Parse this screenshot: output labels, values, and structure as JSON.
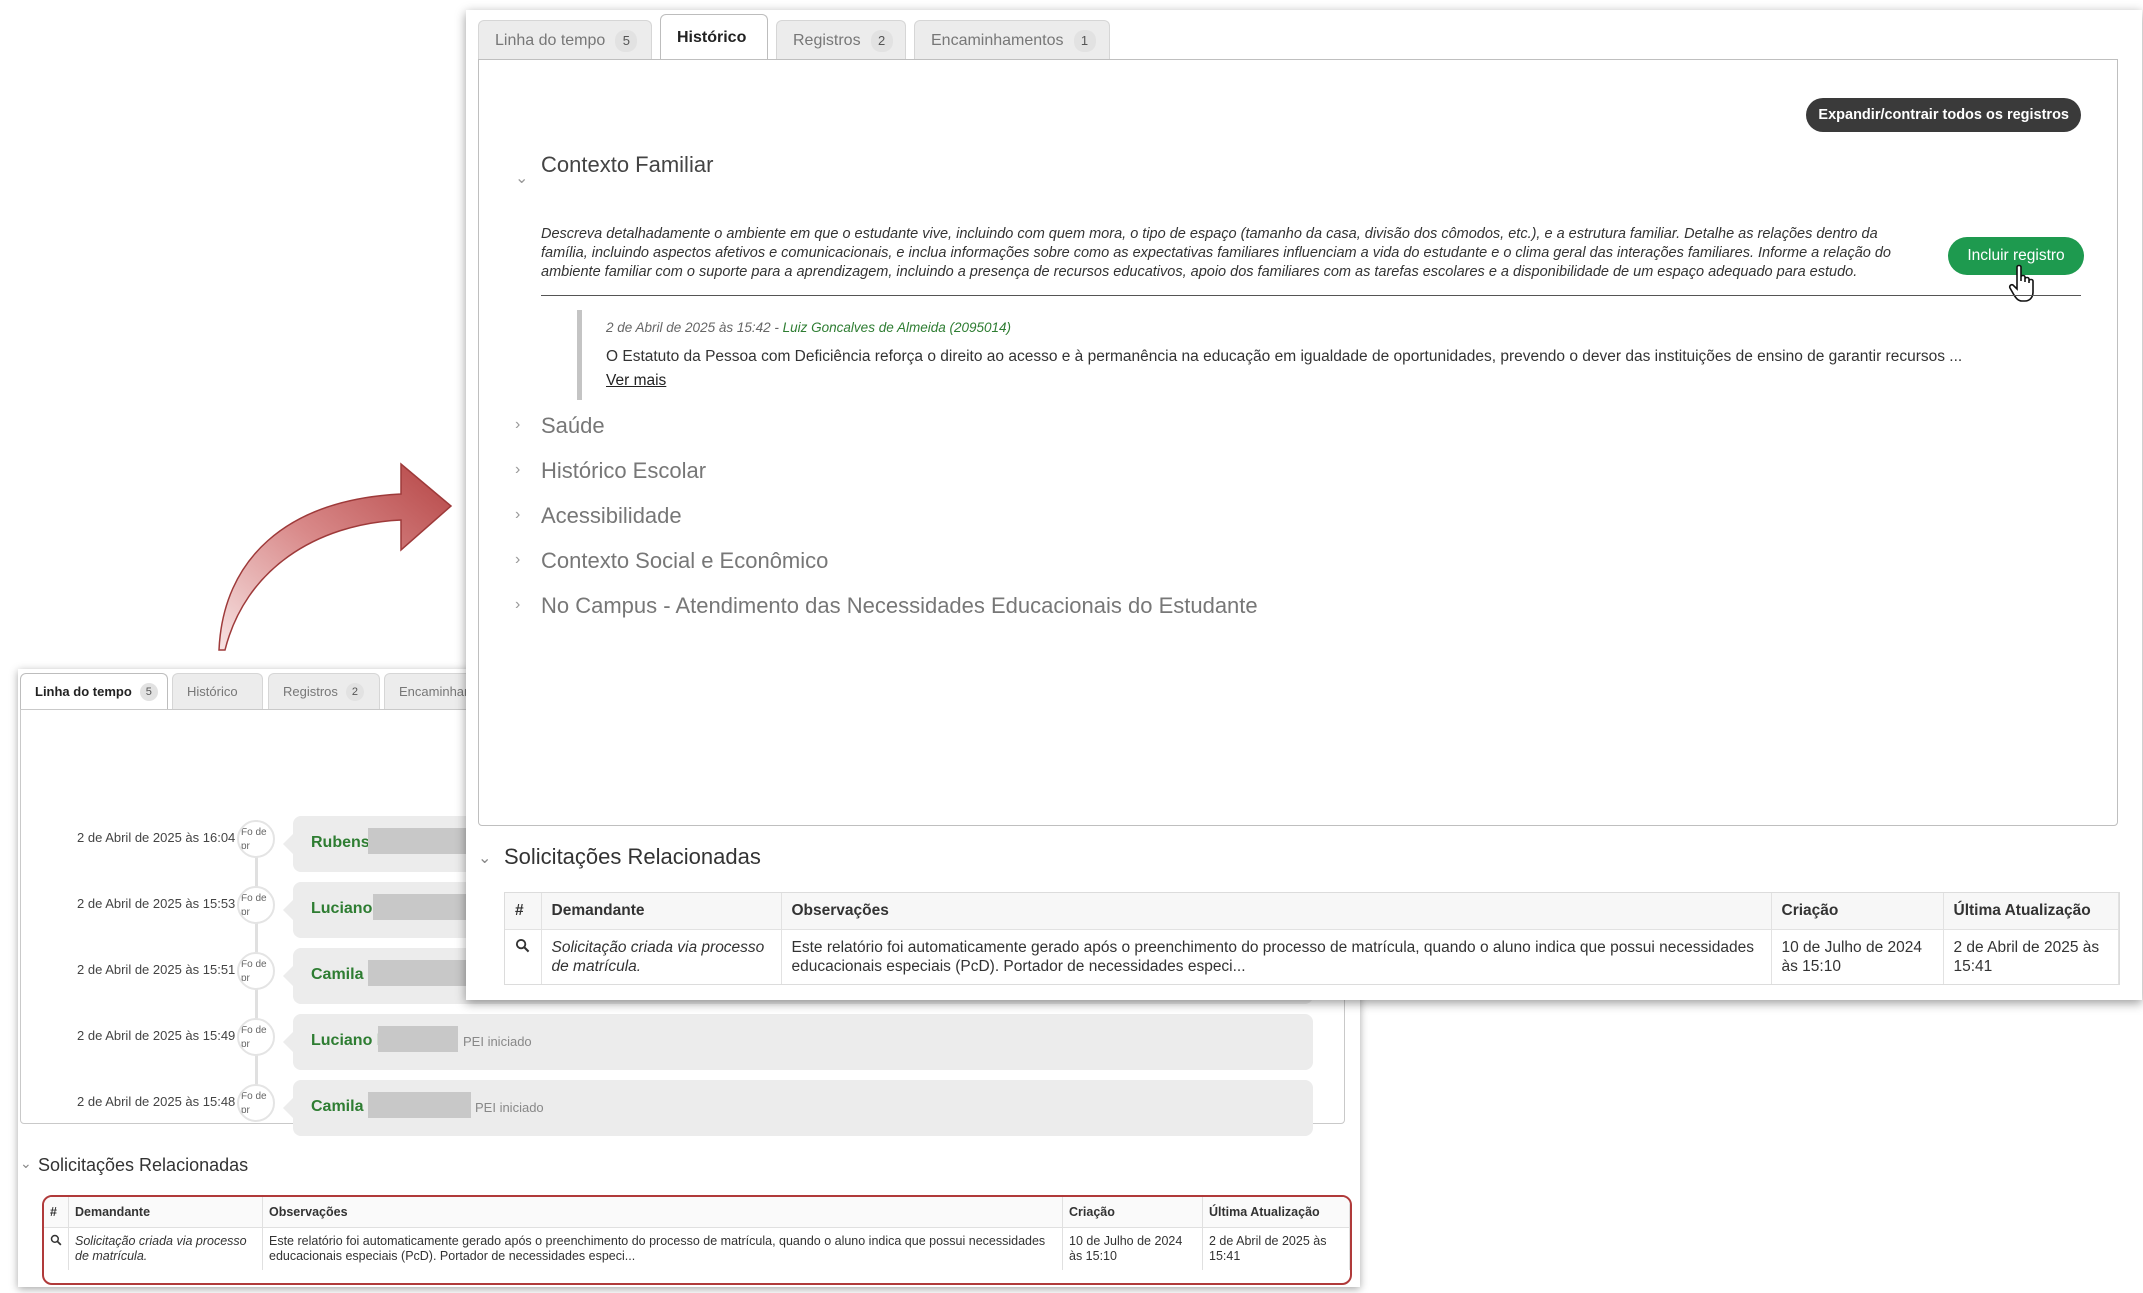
{
  "back": {
    "tabs": [
      {
        "label": "Linha do tempo",
        "count": "5"
      },
      {
        "label": "Histórico",
        "count": ""
      },
      {
        "label": "Registros",
        "count": "2"
      },
      {
        "label": "Encaminham",
        "count": ""
      }
    ],
    "timeline": [
      {
        "date": "2 de Abril de 2025 às 16:04",
        "avatar_alt": "Fo de pr",
        "name": "Rubens",
        "action": ""
      },
      {
        "date": "2 de Abril de 2025 às 15:53",
        "avatar_alt": "Fo de pr",
        "name": "Luciano",
        "action": ""
      },
      {
        "date": "2 de Abril de 2025 às 15:51",
        "avatar_alt": "Fo de pr",
        "name": "Camila",
        "action": ""
      },
      {
        "date": "2 de Abril de 2025 às 15:49",
        "avatar_alt": "Fo de pr",
        "name": "Luciano l",
        "action": "PEI iniciado"
      },
      {
        "date": "2 de Abril de 2025 às 15:48",
        "avatar_alt": "Fo de pr",
        "name": "Camila",
        "action": "PEI iniciado"
      }
    ],
    "solicitacoes": {
      "title": "Solicitações Relacionadas",
      "headers": [
        "#",
        "Demandante",
        "Observações",
        "Criação",
        "Última Atualização"
      ],
      "row": {
        "demandante": "Solicitação criada via processo de matrícula.",
        "observacoes": "Este relatório foi automaticamente gerado após o preenchimento do processo de matrícula, quando o aluno indica que possui necessidades educacionais especiais (PcD). Portador de necessidades especi...",
        "criacao": "10 de Julho de 2024 às 15:10",
        "atualizacao": "2 de Abril de 2025 às 15:41"
      }
    }
  },
  "front": {
    "tabs": [
      {
        "label": "Linha do tempo",
        "count": "5"
      },
      {
        "label": "Histórico",
        "count": ""
      },
      {
        "label": "Registros",
        "count": "2"
      },
      {
        "label": "Encaminhamentos",
        "count": "1"
      }
    ],
    "expand_label": "Expandir/contrair todos os registros",
    "incluir_label": "Incluir registro",
    "sections": {
      "contexto_familiar": "Contexto Familiar",
      "saude": "Saúde",
      "historico_escolar": "Histórico Escolar",
      "acessibilidade": "Acessibilidade",
      "contexto_social": "Contexto Social e Econômico",
      "no_campus": "No Campus - Atendimento das Necessidades Educacionais do Estudante"
    },
    "description": "Descreva detalhadamente o ambiente em que o estudante vive, incluindo com quem mora, o tipo de espaço (tamanho da casa, divisão dos cômodos, etc.), e a estrutura familiar. Detalhe as relações dentro da família, incluindo aspectos afetivos e comunicacionais, e inclua informações sobre como as expectativas familiares influenciam a vida do estudante e o clima geral das interações familiares. Informe a relação do ambiente familiar com o suporte para a aprendizagem, incluindo a presença de recursos educativos, apoio dos familiares com as tarefas escolares e a disponibilidade de um espaço adequado para estudo.",
    "record": {
      "date": "2 de Abril de 2025 às 15:42 -",
      "author": "Luiz Goncalves de Almeida (2095014)",
      "text": "O Estatuto da Pessoa com Deficiência reforça o direito ao acesso e à permanência na educação em igualdade de oportunidades, prevendo o dever das instituições de ensino de garantir recursos ...",
      "more": "Ver mais"
    },
    "solicitacoes": {
      "title": "Solicitações Relacionadas",
      "headers": [
        "#",
        "Demandante",
        "Observações",
        "Criação",
        "Última Atualização"
      ],
      "row": {
        "demandante": "Solicitação criada via processo de matrícula.",
        "observacoes": "Este relatório foi automaticamente gerado após o preenchimento do processo de matrícula, quando o aluno indica que possui necessidades educacionais especiais (PcD). Portador de necessidades especi...",
        "criacao": "10 de Julho de 2024 às 15:10",
        "atualizacao": "2 de Abril de 2025 às 15:41"
      }
    }
  },
  "colors": {
    "accent_green": "#1e9a4f",
    "name_green": "#2e7d32",
    "highlight_red": "#b03a3a",
    "dark_button": "#3a3a3a"
  }
}
